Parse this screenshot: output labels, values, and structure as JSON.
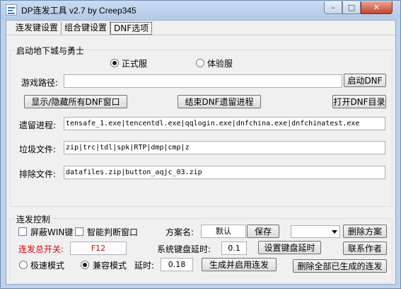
{
  "window": {
    "title": "DP连发工具 v2.7 by Creep345",
    "min": "–",
    "max": "□",
    "close": "✕"
  },
  "tabs": [
    "连发键设置",
    "组合键设置",
    "DNF选项"
  ],
  "dnf": {
    "group_title": "启动地下城与勇士",
    "server_official": "正式服",
    "server_trial": "体验服",
    "game_path_label": "游戏路径:",
    "game_path_value": "",
    "launch_button": "启动DNF",
    "toggle_windows_button": "显示/隐藏所有DNF窗口",
    "kill_residual_button": "结束DNF遗留进程",
    "open_dir_button": "打开DNF目录",
    "residual_label": "遗留进程:",
    "residual_value": "tensafe_1.exe|tencentdl.exe|qqlogin.exe|dnfchina.exe|dnfchinatest.exe",
    "junk_label": "垃圾文件:",
    "junk_value": "zip|trc|tdl|spk|RTP|dmp|cmp|z",
    "exclude_label": "排除文件:",
    "exclude_value": "datafiles.zip|button_aqjc_03.zip"
  },
  "control": {
    "group_title": "连发控制",
    "block_win": "屏蔽WIN键",
    "smart_window": "智能判断窗口",
    "scheme_label": "方案名:",
    "scheme_value": "默认",
    "save_button": "保存",
    "scheme_select": "",
    "delete_scheme_button": "删除方案",
    "master_switch_label": "连发总开关:",
    "master_switch_value": "F12",
    "sys_delay_label": "系统键盘延时:",
    "sys_delay_value": "0.1",
    "set_delay_button": "设置键盘延时",
    "contact_button": "联系作者",
    "mode_fast": "极速模式",
    "mode_compat": "兼容模式",
    "delay_label": "延时:",
    "delay_value": "0.18",
    "generate_button": "生成并启用连发",
    "delete_all_button": "删除全部已生成的连发"
  }
}
